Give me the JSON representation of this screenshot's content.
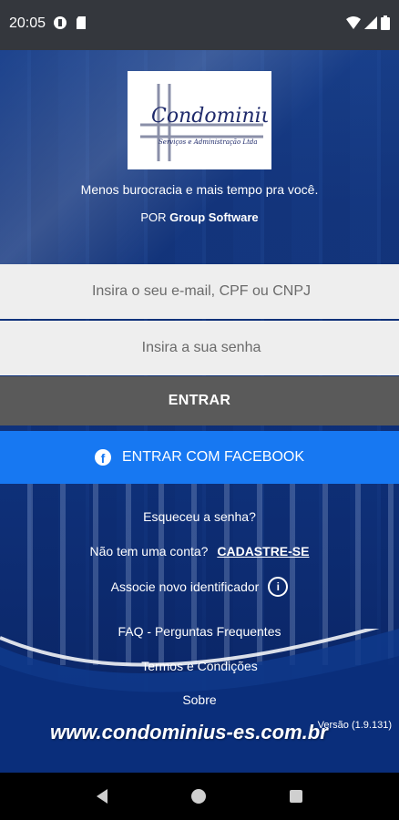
{
  "status_bar": {
    "time": "20:05",
    "left_icons": [
      "data-saver-icon",
      "sd-card-icon"
    ],
    "right_icons": [
      "wifi-icon",
      "cell-signal-icon",
      "battery-icon"
    ]
  },
  "logo": {
    "brand": "Condominius",
    "subtitle": "Serviços e Administração Ltda"
  },
  "tagline": "Menos burocracia e mais tempo pra você.",
  "byline": {
    "prefix": "POR",
    "company": "Group Software"
  },
  "login": {
    "email_placeholder": "Insira o seu e-mail, CPF ou CNPJ",
    "password_placeholder": "Insira a sua senha",
    "submit_label": "ENTRAR",
    "facebook_label": "ENTRAR COM FACEBOOK"
  },
  "links": {
    "forgot_password": "Esqueceu a senha?",
    "no_account": "Não tem uma conta?",
    "signup": "CADASTRE-SE",
    "associate": "Associe novo identificador",
    "faq": "FAQ - Perguntas Frequentes",
    "terms": "Termos e Condições",
    "about": "Sobre"
  },
  "footer": {
    "website": "www.condominius-es.com.br",
    "version": "Versão (1.9.131)"
  },
  "colors": {
    "accent_facebook": "#1778f2",
    "button_gray": "#5a5a5a",
    "field_bg": "#eeeeee",
    "background_blue": "#123a86"
  }
}
